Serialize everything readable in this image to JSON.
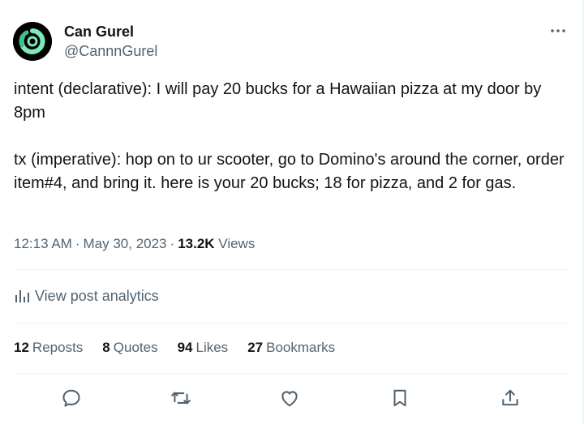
{
  "author": {
    "name": "Can Gurel",
    "handle": "@CannnGurel"
  },
  "tweet": {
    "paragraphs": [
      "intent (declarative): I will pay 20 bucks for a Hawaiian pizza at my door by 8pm",
      "tx (imperative): hop on to ur scooter, go to Domino's around the corner, order item#4, and bring it. here is your 20 bucks; 18 for pizza, and 2 for gas."
    ],
    "time": "12:13 AM",
    "date": "May 30, 2023",
    "views_count": "13.2K",
    "views_label": "Views"
  },
  "analytics_label": "View post analytics",
  "stats": {
    "reposts": {
      "count": "12",
      "label": "Reposts"
    },
    "quotes": {
      "count": "8",
      "label": "Quotes"
    },
    "likes": {
      "count": "94",
      "label": "Likes"
    },
    "bookmarks": {
      "count": "27",
      "label": "Bookmarks"
    }
  },
  "icons": {
    "more": "more-icon",
    "analytics": "analytics-icon",
    "reply": "reply-icon",
    "repost": "repost-icon",
    "like": "like-icon",
    "bookmark": "bookmark-icon",
    "share": "share-icon"
  },
  "colors": {
    "text_primary": "#0f1419",
    "text_secondary": "#536471",
    "divider": "#eff3f4",
    "avatar_bg": "#000000",
    "avatar_accent": "#7de8b8"
  }
}
